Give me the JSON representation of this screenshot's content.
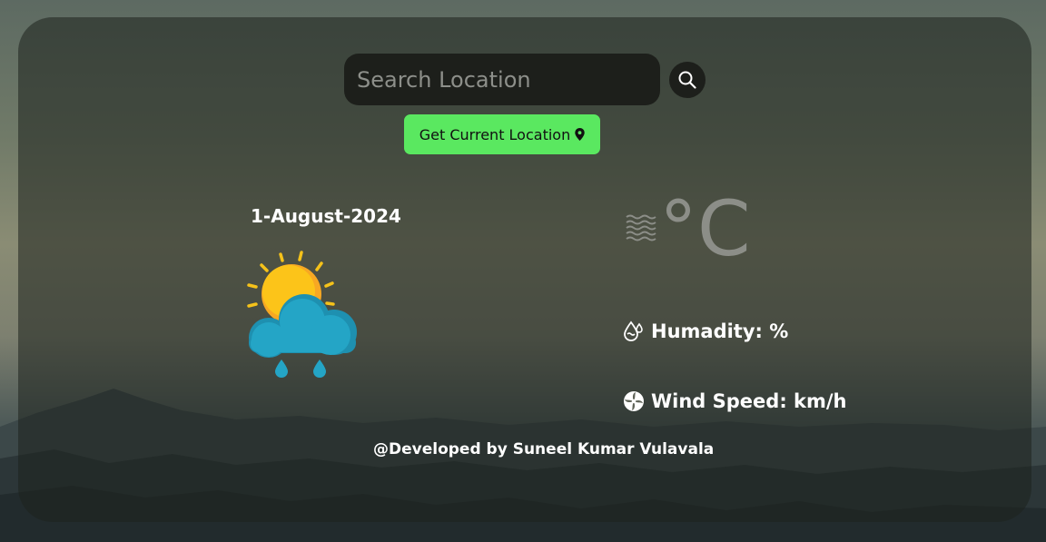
{
  "search": {
    "placeholder": "Search Location",
    "button_icon": "search-icon"
  },
  "location_button": {
    "label": "Get Current Location",
    "icon": "map-pin-icon",
    "color": "#5ae860"
  },
  "weather": {
    "date": "1-August-2024",
    "icon": "sun-behind-rain-cloud-icon",
    "temperature_value": "",
    "temperature_unit": "°C",
    "haze_icon": "haze-icon",
    "humidity_label": "Humadity: %",
    "humidity_icon": "humidity-drop-icon",
    "wind_label": "Wind Speed: km/h",
    "wind_icon": "wind-fan-icon"
  },
  "footer": {
    "credit": "@Developed by Suneel Kumar Vulavala"
  }
}
